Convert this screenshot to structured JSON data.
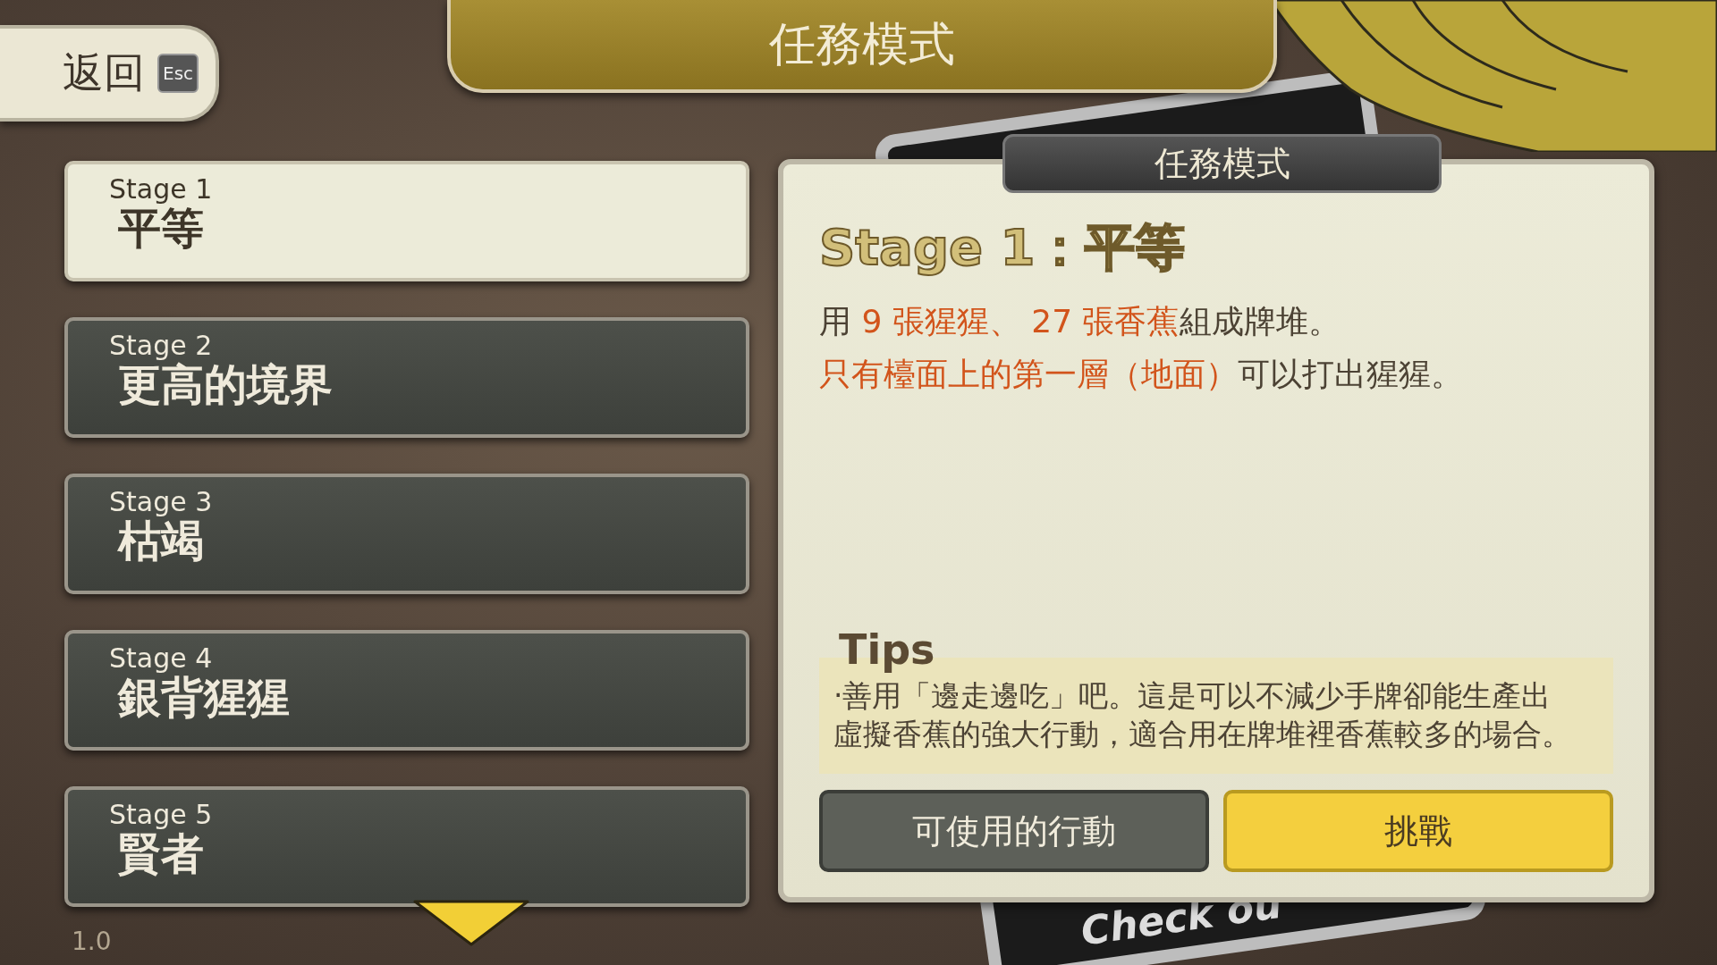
{
  "back_button": {
    "label": "返回",
    "key": "Esc"
  },
  "title": "任務模式",
  "stages": [
    {
      "number": "Stage 1",
      "name": "平等",
      "selected": true
    },
    {
      "number": "Stage 2",
      "name": "更高的境界",
      "selected": false
    },
    {
      "number": "Stage 3",
      "name": "枯竭",
      "selected": false
    },
    {
      "number": "Stage 4",
      "name": "銀背猩猩",
      "selected": false
    },
    {
      "number": "Stage 5",
      "name": "賢者",
      "selected": false
    }
  ],
  "version": "1.0",
  "background_card": {
    "text": "Check ou"
  },
  "panel": {
    "header": "任務模式",
    "stage_title": "Stage 1：平等",
    "description": [
      [
        {
          "text": "用 ",
          "highlight": false
        },
        {
          "text": "9 張猩猩、 27 張香蕉",
          "highlight": true
        },
        {
          "text": "組成牌堆。",
          "highlight": false
        }
      ],
      [
        {
          "text": "只有檯面上的第一層（地面）",
          "highlight": true
        },
        {
          "text": "可以打出猩猩。",
          "highlight": false
        }
      ]
    ],
    "tips_title": "Tips",
    "tips": "·善用「邊走邊吃」吧。這是可以不減少手牌卻能生產出虛擬香蕉的強大行動，適合用在牌堆裡香蕉較多的場合。",
    "buttons": [
      {
        "label": "可使用的行動",
        "kind": "secondary"
      },
      {
        "label": "挑戰",
        "kind": "primary"
      }
    ]
  }
}
